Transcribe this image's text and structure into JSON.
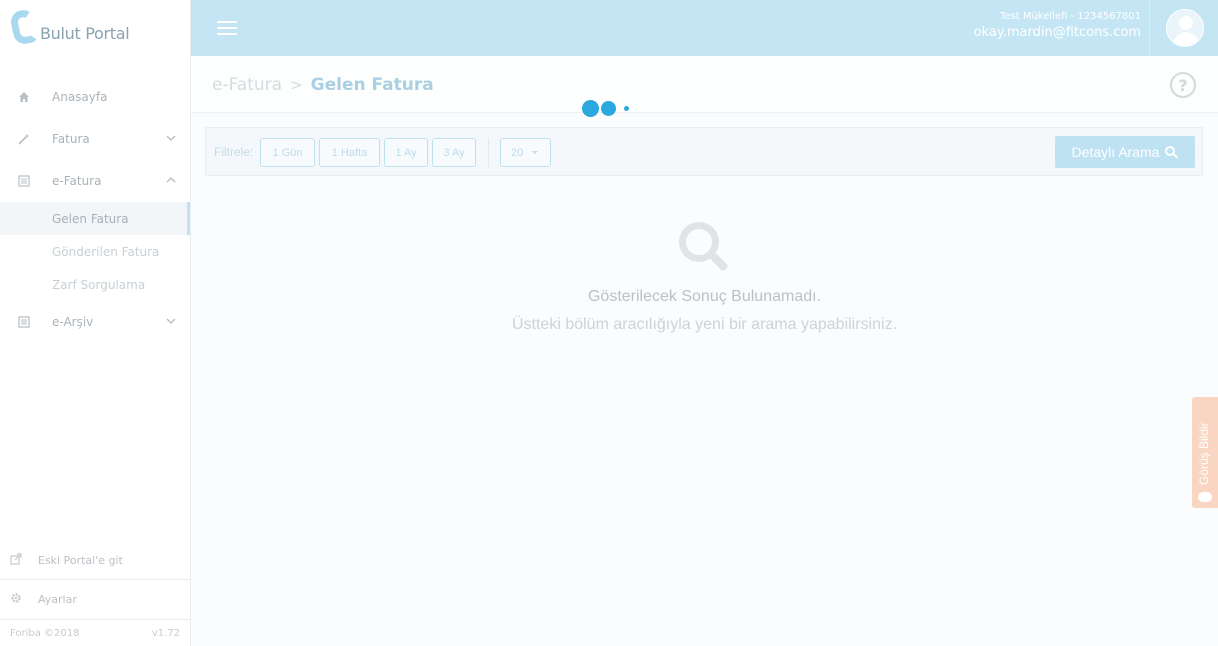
{
  "brand": {
    "name": "Bulut Portal"
  },
  "sidebar": {
    "items": [
      {
        "label": "Anasayfa",
        "icon": "home-icon"
      },
      {
        "label": "Fatura",
        "icon": "magic-wand-icon"
      },
      {
        "label": "e-Fatura",
        "icon": "list-icon"
      },
      {
        "label": "e-Arşiv",
        "icon": "list-icon"
      }
    ],
    "efatura_sub": [
      {
        "label": "Gelen Fatura",
        "active": true
      },
      {
        "label": "Gönderilen Fatura",
        "active": false
      },
      {
        "label": "Zarf Sorgulama",
        "active": false
      }
    ],
    "old_portal": "Eski Portal'e git",
    "settings": "Ayarlar",
    "copyright": "Foriba ©2018",
    "version": "v1.72"
  },
  "header": {
    "company": "Test Mükellefi - 1234567801",
    "email": "okay.mardin@fitcons.com"
  },
  "breadcrumb": {
    "parent": "e-Fatura",
    "separator": ">",
    "current": "Gelen Fatura"
  },
  "filters": {
    "label": "Filtrele:",
    "buttons": [
      "1 Gün",
      "1 Hafta",
      "1 Ay",
      "3 Ay"
    ],
    "page_size": "20",
    "detail_search": "Detaylı Arama"
  },
  "empty_state": {
    "title": "Gösterilecek Sonuç Bulunamadı.",
    "subtitle": "Üstteki bölüm aracılığıyla yeni bir arama yapabilirsiniz."
  },
  "feedback": {
    "label": "Görüş Bildir"
  },
  "colors": {
    "topbar": "#c4e6f4",
    "accent": "#2ba8dd",
    "feedback": "#fad6c2"
  }
}
